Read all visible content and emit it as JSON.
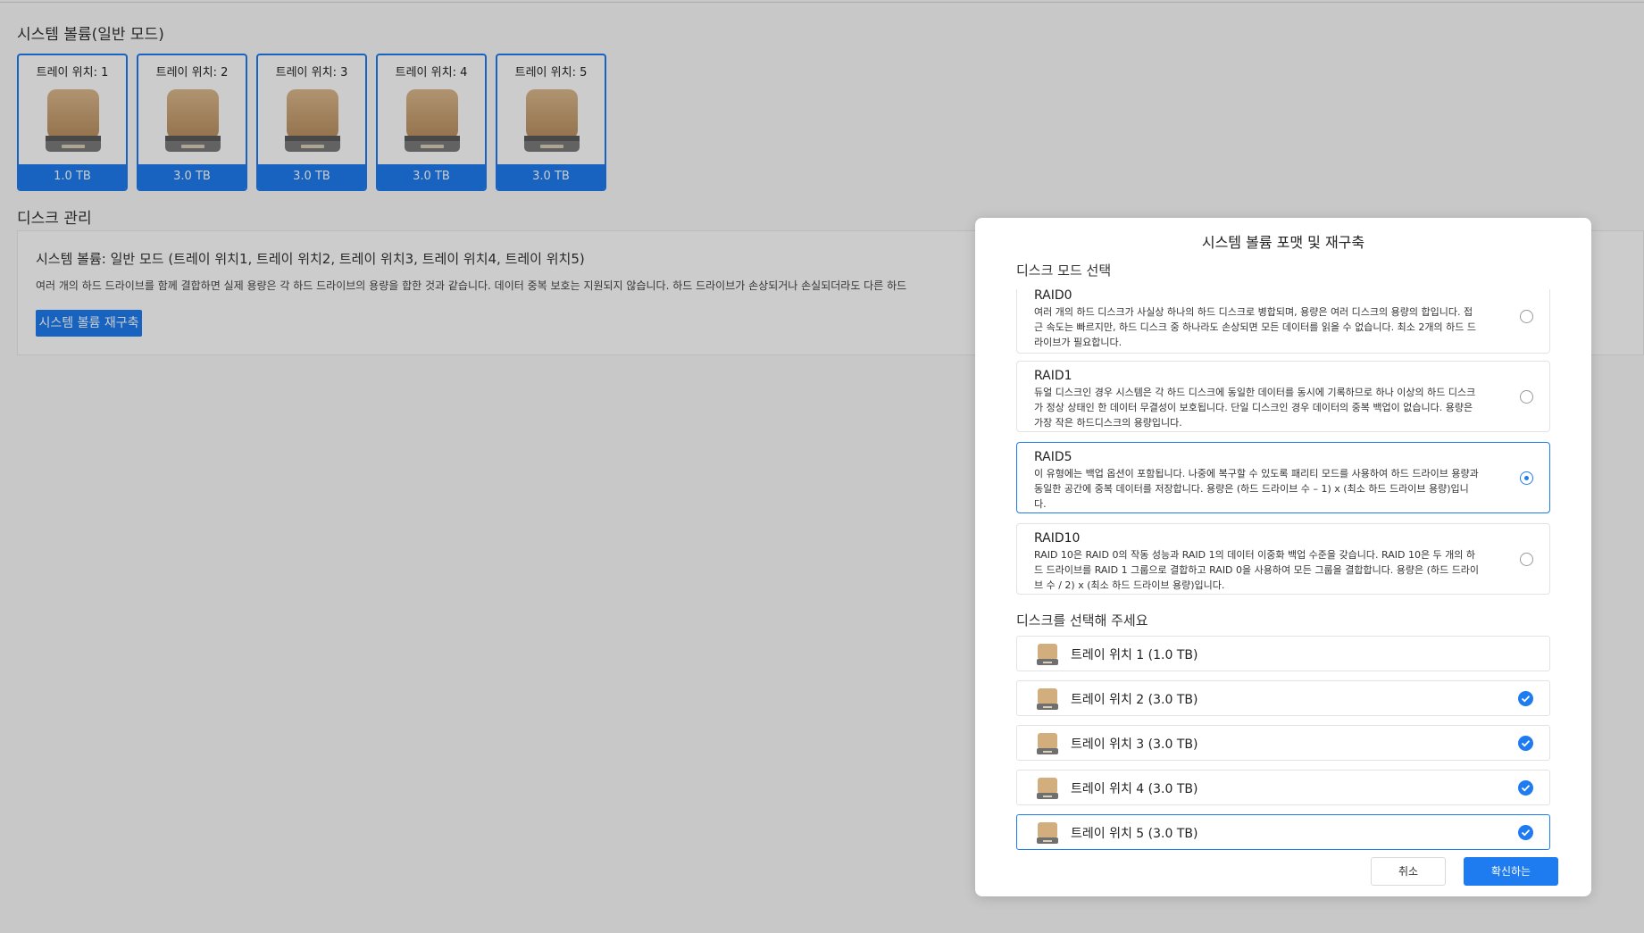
{
  "page": {
    "system_volume_title": "시스템 볼륨(일반 모드)",
    "disk_management_title": "디스크 관리",
    "trays": [
      {
        "label": "트레이 위치: 1",
        "size": "1.0 TB"
      },
      {
        "label": "트레이 위치: 2",
        "size": "3.0 TB"
      },
      {
        "label": "트레이 위치: 3",
        "size": "3.0 TB"
      },
      {
        "label": "트레이 위치: 4",
        "size": "3.0 TB"
      },
      {
        "label": "트레이 위치: 5",
        "size": "3.0 TB"
      }
    ],
    "management": {
      "volume_info": "시스템 볼륨: 일반 모드 (트레이 위치1, 트레이 위치2, 트레이 위치3, 트레이 위치4, 트레이 위치5)",
      "description": "여러 개의 하드 드라이브를 함께 결합하면 실제 용량은 각 하드 드라이브의 용량을 합한 것과 같습니다. 데이터 중복 보호는 지원되지 않습니다. 하드 드라이브가 손상되거나 손실되더라도 다른 하드",
      "rebuild_button": "시스템 볼륨 재구축"
    }
  },
  "modal": {
    "title": "시스템 볼륨 포맷 및 재구축",
    "disk_mode_label": "디스크 모드 선택",
    "raid_options": [
      {
        "name": "RAID0",
        "desc": "여러 개의 하드 디스크가 사실상 하나의 하드 디스크로 병합되며, 용량은 여러 디스크의 용량의 합입니다. 접근 속도는 빠르지만, 하드 디스크 중 하나라도 손상되면 모든 데이터를 읽을 수 없습니다. 최소 2개의 하드 드라이브가 필요합니다.",
        "selected": false
      },
      {
        "name": "RAID1",
        "desc": "듀얼 디스크인 경우 시스템은 각 하드 디스크에 동일한 데이터를 동시에 기록하므로 하나 이상의 하드 디스크가 정상 상태인 한 데이터 무결성이 보호됩니다. 단일 디스크인 경우 데이터의 중복 백업이 없습니다. 용량은 가장 작은 하드디스크의 용량입니다.",
        "selected": false
      },
      {
        "name": "RAID5",
        "desc": "이 유형에는 백업 옵션이 포함됩니다. 나중에 복구할 수 있도록 패리티 모드를 사용하여 하드 드라이브 용량과 동일한 공간에 중복 데이터를 저장합니다. 용량은 (하드 드라이브 수 – 1) x (최소 하드 드라이브 용량)입니다.",
        "selected": true
      },
      {
        "name": "RAID10",
        "desc": "RAID 10은 RAID 0의 작동 성능과 RAID 1의 데이터 이중화 백업 수준을 갖습니다. RAID 10은 두 개의 하드 드라이브를 RAID 1 그룹으로 결합하고 RAID 0을 사용하여 모든 그룹을 결합합니다. 용량은 (하드 드라이브 수 / 2) x (최소 하드 드라이브 용량)입니다.",
        "selected": false
      }
    ],
    "disk_select_label": "디스크를 선택해 주세요",
    "disks": [
      {
        "label": "트레이 위치  1  (1.0 TB)",
        "checked": false
      },
      {
        "label": "트레이 위치  2  (3.0 TB)",
        "checked": true
      },
      {
        "label": "트레이 위치  3  (3.0 TB)",
        "checked": true
      },
      {
        "label": "트레이 위치  4  (3.0 TB)",
        "checked": true
      },
      {
        "label": "트레이 위치  5  (3.0 TB)",
        "checked": true
      }
    ],
    "cancel_button": "취소",
    "confirm_button": "확신하는"
  },
  "colors": {
    "accent": "#1f7cf0",
    "overlay": "rgba(0,0,0,0.2)"
  },
  "icons": {
    "tray_disk": "hard-drive-icon",
    "check": "check-icon",
    "radio": "radio-icon"
  }
}
